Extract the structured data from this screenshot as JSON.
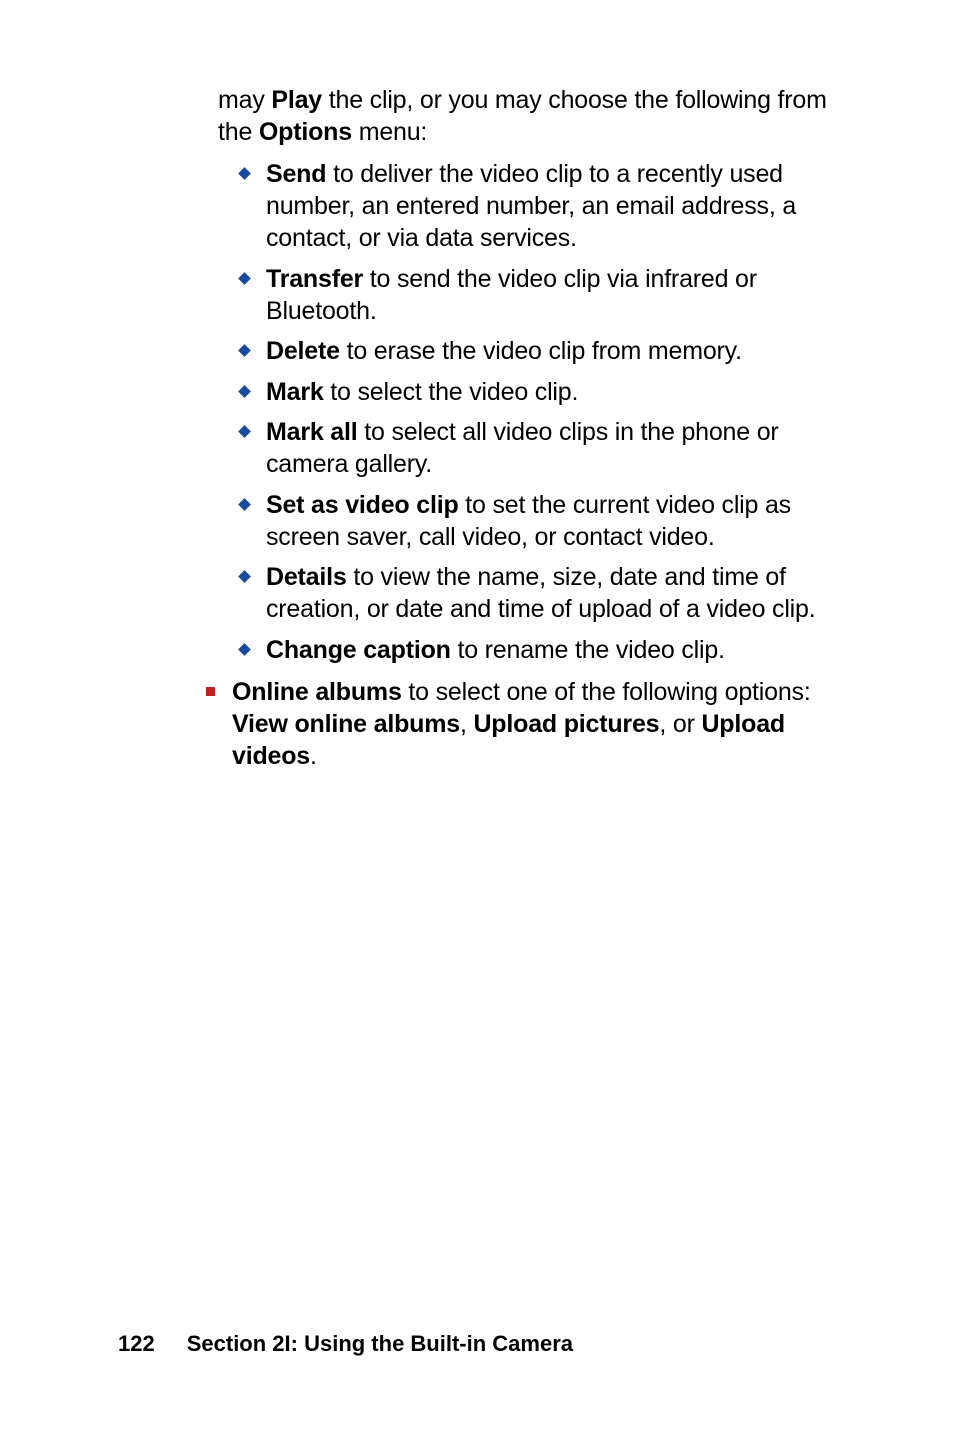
{
  "intro": {
    "pre": "may ",
    "b1": "Play",
    "mid": " the clip, or you may choose the following from the ",
    "b2": "Options",
    "post": " menu:"
  },
  "diamonds": [
    {
      "bold": "Send",
      "rest": " to deliver the video clip to a recently used number, an entered number, an email address, a contact, or via data services."
    },
    {
      "bold": "Transfer",
      "rest": " to send the video clip via infrared or Bluetooth."
    },
    {
      "bold": "Delete",
      "rest": " to erase the video clip from memory."
    },
    {
      "bold": "Mark",
      "rest": " to select the video clip."
    },
    {
      "bold": "Mark all",
      "rest": " to select all video clips in the phone or camera gallery."
    },
    {
      "bold": "Set as video clip",
      "rest": " to set the current video clip as screen saver, call video, or contact video."
    },
    {
      "bold": "Details",
      "rest": " to view the name, size, date and time of creation, or date and time of upload of a video clip."
    },
    {
      "bold": "Change caption",
      "rest": " to rename the video clip."
    }
  ],
  "square": {
    "bold": "Online albums",
    "mid1": " to select one of the following options: ",
    "b2": "View online albums",
    "sep1": ", ",
    "b3": "Upload pictures",
    "sep2": ", or ",
    "b4": "Upload videos",
    "end": "."
  },
  "footer": {
    "page": "122",
    "section": "Section 2I: Using the Built-in Camera"
  }
}
